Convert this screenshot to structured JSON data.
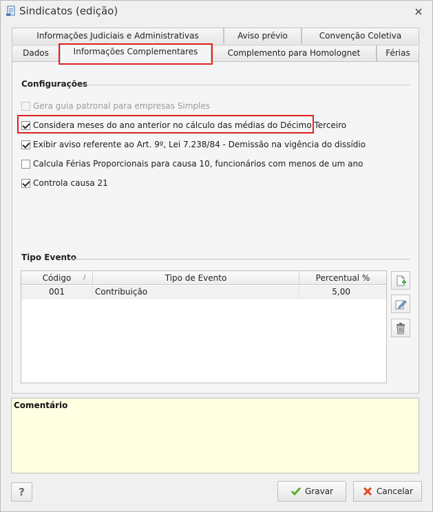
{
  "window": {
    "title": "Sindicatos (edição)"
  },
  "tabs": {
    "row_top": [
      "Informações Judiciais e Administrativas",
      "Aviso prévio",
      "Convenção Coletiva"
    ],
    "row_bottom": [
      "Dados",
      "Informações Complementares",
      "Complemento para Homolognet",
      "Férias"
    ],
    "active": "Informações Complementares"
  },
  "configuracoes": {
    "title": "Configurações",
    "options": [
      {
        "label": "Gera guia patronal para empresas Simples",
        "checked": false,
        "enabled": false
      },
      {
        "label": "Considera meses do ano anterior no cálculo das médias do Décimo Terceiro",
        "checked": true,
        "enabled": true
      },
      {
        "label": "Exibir aviso referente ao Art. 9º, Lei 7.238/84 - Demissão na vigência do dissídio",
        "checked": true,
        "enabled": true
      },
      {
        "label": "Calcula Férias Proporcionais para causa 10, funcionários com menos de um ano",
        "checked": false,
        "enabled": true
      },
      {
        "label": "Controla causa 21",
        "checked": true,
        "enabled": true
      }
    ]
  },
  "tipo_evento": {
    "title": "Tipo Evento",
    "columns": [
      "Código",
      "Tipo de Evento",
      "Percentual %"
    ],
    "sort_indicator": "/",
    "rows": [
      {
        "codigo": "001",
        "tipo": "Contribuição",
        "percentual": "5,00"
      }
    ]
  },
  "comentario": {
    "label": "Comentário"
  },
  "footer": {
    "help": "?",
    "save": "Gravar",
    "cancel": "Cancelar"
  }
}
